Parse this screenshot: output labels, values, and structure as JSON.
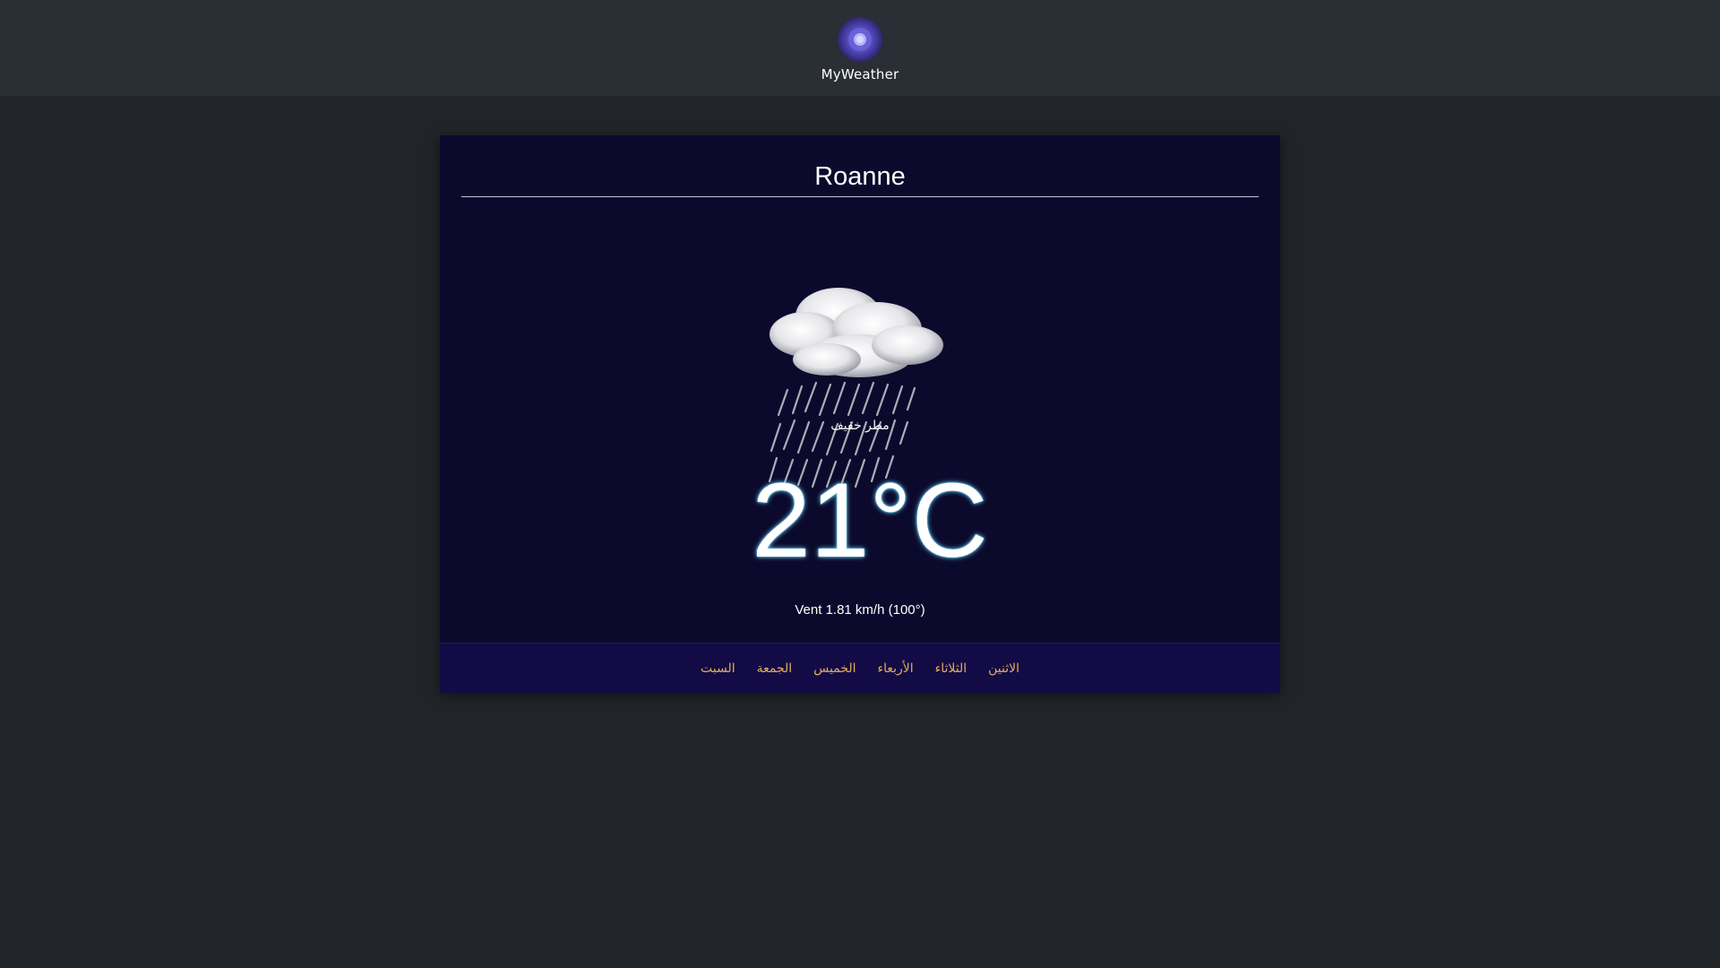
{
  "app": {
    "name": "MyWeather"
  },
  "location": {
    "city": "Roanne"
  },
  "current": {
    "condition": "مطر خفيف",
    "temperature": "21°C",
    "wind": "Vent 1.81 km/h (100°)",
    "icon": "light-rain-cloud-icon"
  },
  "days": [
    {
      "label": "الاثنين"
    },
    {
      "label": "الثلاثاء"
    },
    {
      "label": "الأربعاء"
    },
    {
      "label": "الخميس"
    },
    {
      "label": "الجمعة"
    },
    {
      "label": "السبت"
    }
  ],
  "colors": {
    "page_bg": "#212529",
    "header_bg": "#2a2e35",
    "card_bg": "#0c0a2c",
    "days_bar_bg": "#130b45",
    "day_link": "#e2ac5f",
    "logo_accent": "#5a52c9"
  }
}
